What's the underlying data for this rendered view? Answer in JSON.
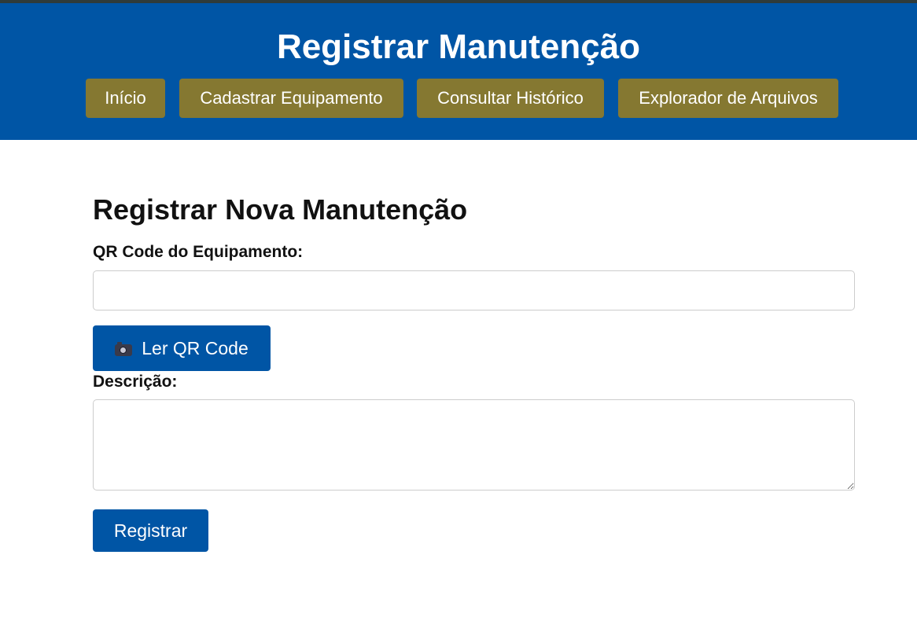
{
  "header": {
    "title": "Registrar Manutenção",
    "background_color": "#0055a5",
    "nav": [
      {
        "label": "Início"
      },
      {
        "label": "Cadastrar Equipamento"
      },
      {
        "label": "Consultar Histórico"
      },
      {
        "label": "Explorador de Arquivos"
      }
    ],
    "nav_button_color": "#857831"
  },
  "form": {
    "title": "Registrar Nova Manutenção",
    "qr_label": "QR Code do Equipamento:",
    "qr_value": "",
    "scan_button_icon": "camera-icon",
    "scan_button_label": "Ler QR Code",
    "description_label": "Descrição:",
    "description_value": "",
    "submit_label": "Registrar",
    "primary_color": "#0055a5"
  }
}
